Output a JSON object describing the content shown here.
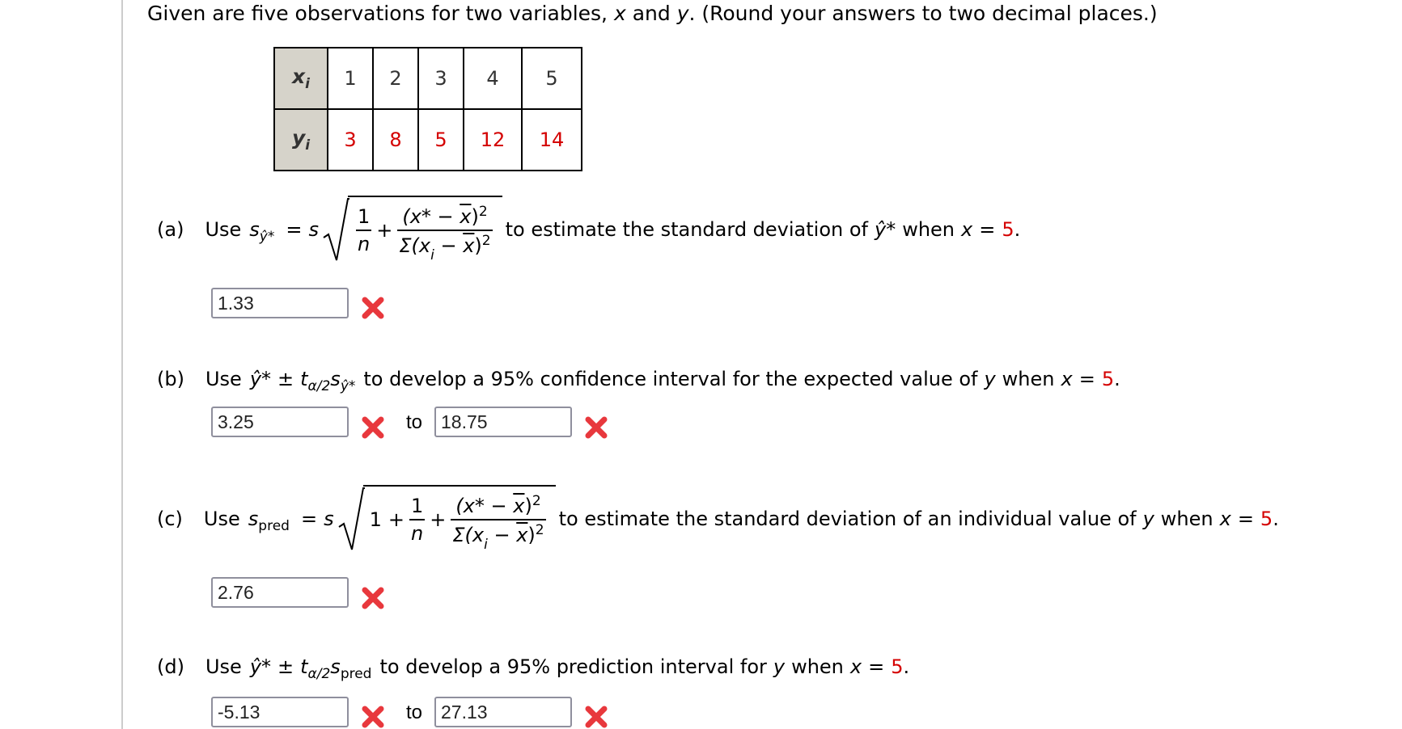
{
  "intro": {
    "text_1": "Given are five observations for two variables, ",
    "var_x": "x",
    "text_2": " and ",
    "var_y": "y",
    "text_3": ". (Round your answers to two decimal places.)"
  },
  "table": {
    "row_x_label": "x",
    "row_y_label": "y",
    "subscript": "i",
    "x_values": [
      "1",
      "2",
      "3",
      "4",
      "5"
    ],
    "y_values": [
      "3",
      "8",
      "5",
      "12",
      "14"
    ]
  },
  "colors": {
    "given_value": "#d40000",
    "incorrect": "#e8383d",
    "table_header_bg": "#d6d3ca"
  },
  "parts": {
    "a": {
      "label": "(a)",
      "use": "Use",
      "description": "to estimate the standard deviation of",
      "yhat": "ŷ*",
      "when": "when",
      "x": "x",
      "equals": "=",
      "value": "5",
      "period": ".",
      "answer": "1.33",
      "status": "incorrect"
    },
    "b": {
      "label": "(b)",
      "use": "Use",
      "description": "to develop a 95% confidence interval for the expected value of",
      "y": "y",
      "when": "when",
      "x": "x",
      "equals": "=",
      "value": "5",
      "period": ".",
      "lower": "3.25",
      "to": "to",
      "upper": "18.75",
      "lower_status": "incorrect",
      "upper_status": "incorrect"
    },
    "c": {
      "label": "(c)",
      "use": "Use",
      "description": "to estimate the standard deviation of an individual value of",
      "y": "y",
      "when": "when",
      "x": "x",
      "equals": "=",
      "value": "5",
      "period": ".",
      "answer": "2.76",
      "status": "incorrect"
    },
    "d": {
      "label": "(d)",
      "use": "Use",
      "description": "to develop a 95% prediction interval for",
      "y": "y",
      "when": "when",
      "x": "x",
      "equals": "=",
      "value": "5",
      "period": ".",
      "lower": "-5.13",
      "to": "to",
      "upper": "27.13",
      "lower_status": "incorrect",
      "upper_status": "incorrect"
    }
  },
  "formula": {
    "s": "s",
    "yhat_star": "ŷ*",
    "pred": "pred",
    "equals": "=",
    "one": "1",
    "n": "n",
    "plus": "+",
    "pm": "±",
    "t": "t",
    "alpha_half": "α/2",
    "num_open": "(x* − ",
    "xbar": "x",
    "close_sq": ")",
    "two": "2",
    "den_open": "Σ(x",
    "i": "i",
    "minus": " − "
  }
}
